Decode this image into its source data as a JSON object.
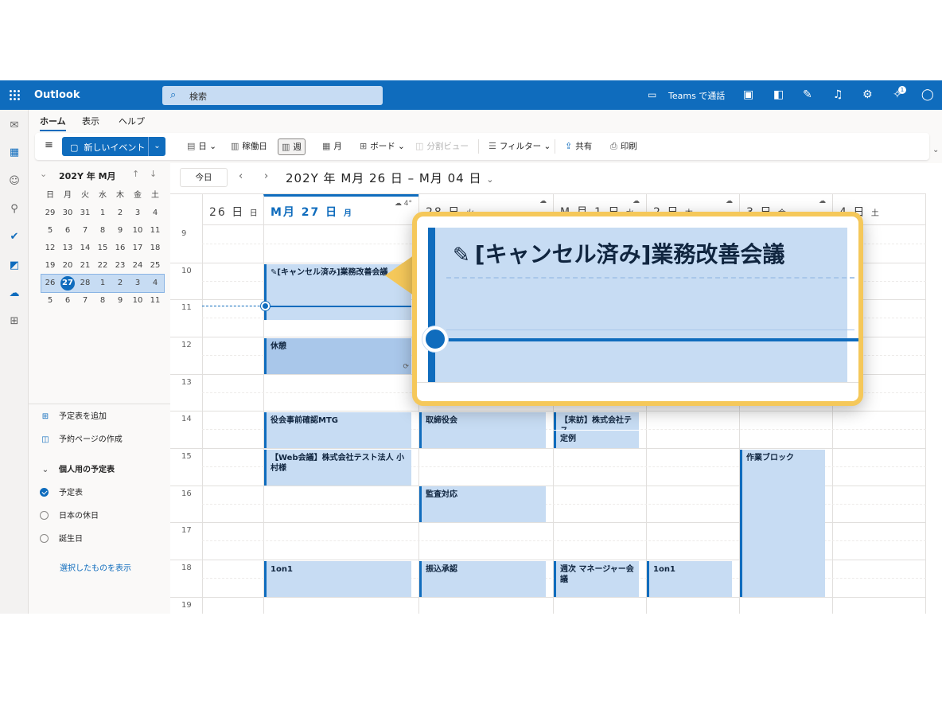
{
  "topbar": {
    "app_name": "Outlook",
    "search_placeholder": "検索",
    "teams_label": "Teams で通話",
    "notif_count": "1"
  },
  "tabs": [
    "ホーム",
    "表示",
    "ヘルプ"
  ],
  "ribbon": {
    "new_event": "新しいイベント",
    "day": "日",
    "workweek": "稼働日",
    "week": "週",
    "month": "月",
    "board": "ボード",
    "split": "分割ビュー",
    "filter": "フィルター",
    "share": "共有",
    "print": "印刷"
  },
  "minical": {
    "title": "202Y 年 M月",
    "weekdays": [
      "日",
      "月",
      "火",
      "水",
      "木",
      "金",
      "土"
    ],
    "rows": [
      [
        "29",
        "30",
        "31",
        "1",
        "2",
        "3",
        "4"
      ],
      [
        "5",
        "6",
        "7",
        "8",
        "9",
        "10",
        "11"
      ],
      [
        "12",
        "13",
        "14",
        "15",
        "16",
        "17",
        "18"
      ],
      [
        "19",
        "20",
        "21",
        "22",
        "23",
        "24",
        "25"
      ],
      [
        "26",
        "27",
        "28",
        "1",
        "2",
        "3",
        "4"
      ],
      [
        "5",
        "6",
        "7",
        "8",
        "9",
        "10",
        "11"
      ]
    ]
  },
  "sidebar": {
    "add_calendar": "予定表を追加",
    "booking_page": "予約ページの作成",
    "personal_group": "個人用の予定表",
    "cal_main": "予定表",
    "cal_holidays": "日本の休日",
    "cal_birthdays": "誕生日",
    "show_selected": "選択したものを表示"
  },
  "toolbar": {
    "today": "今日",
    "range": "202Y 年 M月 26 日 – M月 04 日"
  },
  "days": [
    {
      "num": "26 日",
      "wd": "日"
    },
    {
      "num": "M月 27 日",
      "wd": "月",
      "weather": "4°"
    },
    {
      "num": "28 日",
      "wd": "火"
    },
    {
      "num": "M 月 1 日",
      "wd": "水"
    },
    {
      "num": "2 日",
      "wd": "木"
    },
    {
      "num": "3 日",
      "wd": "金"
    },
    {
      "num": "4 日",
      "wd": "土"
    }
  ],
  "hours": [
    "9",
    "10",
    "11",
    "12",
    "13",
    "14",
    "15",
    "16",
    "17",
    "18",
    "19"
  ],
  "events": {
    "cancelled": "[キャンセル済み]業務改善会議",
    "break": "休憩",
    "pre_board": "役会事前確認MTG",
    "web_meeting": "【Web会議】株式会社テスト法人 小村様",
    "one_on_one": "1on1",
    "board": "取締役会",
    "audit": "監査対応",
    "transfer": "振込承認",
    "visit": "【来訪】株式会社テス",
    "regular": "定例",
    "weekly_mgr": "週次 マネージャー会議",
    "one_on_one_2": "1on1",
    "work_block": "作業ブロック"
  },
  "zoom": {
    "title": "[キャンセル済み]業務改善会議"
  },
  "colors": {
    "brand": "#0f6cbd",
    "event_fill": "#c7dcf3",
    "callout": "#f5c85a"
  }
}
